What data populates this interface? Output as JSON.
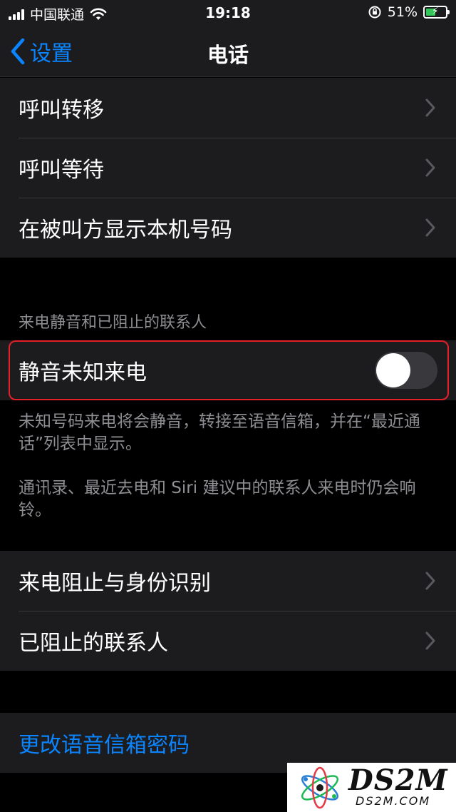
{
  "status_bar": {
    "carrier": "中国联通",
    "time": "19:18",
    "battery_percent": "51%",
    "battery_level": 0.51,
    "battery_color": "#34c759"
  },
  "nav": {
    "back_label": "设置",
    "title": "电话"
  },
  "group1": {
    "items": [
      {
        "label": "呼叫转移"
      },
      {
        "label": "呼叫等待"
      },
      {
        "label": "在被叫方显示本机号码"
      }
    ]
  },
  "silence": {
    "header": "来电静音和已阻止的联系人",
    "toggle_label": "静音未知来电",
    "toggle_on": false,
    "footer_1": "未知号码来电将会静音，转接至语音信箱，并在“最近通话”列表中显示。",
    "footer_2": "通讯录、最近去电和 Siri 建议中的联系人来电时仍会响铃。"
  },
  "group2": {
    "items": [
      {
        "label": "来电阻止与身份识别"
      },
      {
        "label": "已阻止的联系人"
      }
    ]
  },
  "group3": {
    "items": [
      {
        "label": "更改语音信箱密码"
      }
    ]
  },
  "colors": {
    "accent": "#0a84ff",
    "highlight_border": "#e5202b",
    "cell_background": "#1c1c1e",
    "secondary_text": "#8e8e93"
  },
  "watermark": {
    "text": "DS2M",
    "subtext": "DS2M.COM"
  }
}
